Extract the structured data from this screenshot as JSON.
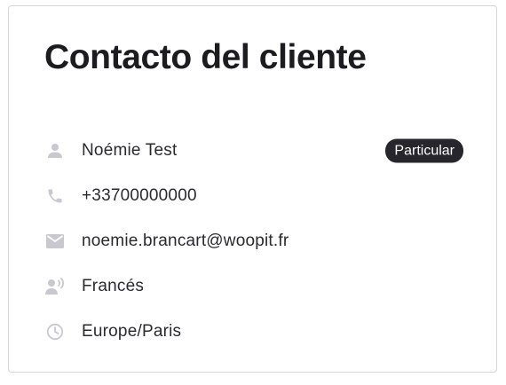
{
  "card": {
    "title": "Contacto del cliente"
  },
  "contact": {
    "name": {
      "icon": "person-icon",
      "value": "Noémie Test"
    },
    "type_badge": "Particular",
    "phone": {
      "icon": "phone-icon",
      "value": "+33700000000"
    },
    "email": {
      "icon": "email-icon",
      "value": "noemie.brancart@woopit.fr"
    },
    "language": {
      "icon": "voice-speaker-icon",
      "value": "Francés"
    },
    "timezone": {
      "icon": "clock-icon",
      "value": "Europe/Paris"
    }
  },
  "colors": {
    "icon": "#c8c8d0",
    "badge_bg": "#26262c",
    "badge_text": "#ffffff",
    "border": "#d6d6d9"
  }
}
